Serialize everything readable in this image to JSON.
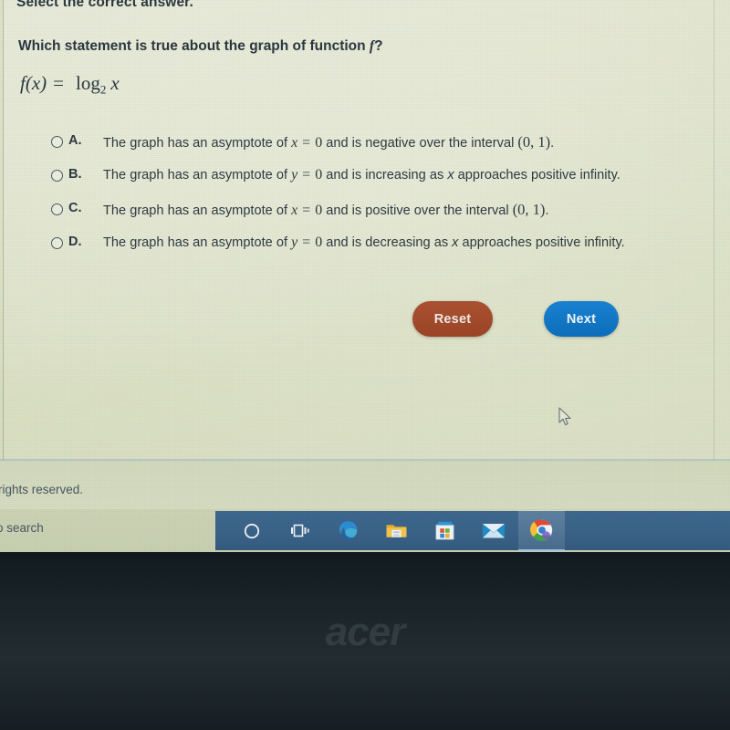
{
  "quiz": {
    "instruction": "Select the correct answer.",
    "question_prefix": "Which statement is true about the graph of function ",
    "question_function": "f",
    "question_suffix": "?",
    "formula": {
      "lhs": "f(x)",
      "equals": "=",
      "log_word": "log",
      "base": "2",
      "argument": "x"
    },
    "options": [
      {
        "letter": "A.",
        "selected": false,
        "text_before_var": "The graph has an asymptote of ",
        "variable": "x",
        "equals": "=",
        "value": "0",
        "text_after": " and is negative over the interval ",
        "interval": "(0, 1)",
        "period": "."
      },
      {
        "letter": "B.",
        "selected": false,
        "text_before_var": "The graph has an asymptote of ",
        "variable": "y",
        "equals": "=",
        "value": "0",
        "text_after": " and is increasing as ",
        "trailing_var": "x",
        "text_end": " approaches positive infinity.",
        "interval": "",
        "period": ""
      },
      {
        "letter": "C.",
        "selected": false,
        "text_before_var": "The graph has an asymptote of ",
        "variable": "x",
        "equals": "=",
        "value": "0",
        "text_after": " and is positive over the interval ",
        "interval": "(0, 1)",
        "period": "."
      },
      {
        "letter": "D.",
        "selected": false,
        "text_before_var": "The graph has an asymptote of ",
        "variable": "y",
        "equals": "=",
        "value": "0",
        "text_after": " and is decreasing as ",
        "trailing_var": "x",
        "text_end": " approaches positive infinity.",
        "interval": "",
        "period": ""
      }
    ],
    "buttons": {
      "reset_label": "Reset",
      "next_label": "Next",
      "reset_color": "#a04a2c",
      "next_color": "#0f74c2"
    }
  },
  "footer": {
    "copyright_text": "rights reserved."
  },
  "taskbar": {
    "search_text": "o search",
    "items": [
      {
        "name": "cortana-icon",
        "label": "Cortana"
      },
      {
        "name": "task-view-icon",
        "label": "Task View"
      },
      {
        "name": "edge-icon",
        "label": "Microsoft Edge"
      },
      {
        "name": "file-explorer-icon",
        "label": "File Explorer"
      },
      {
        "name": "microsoft-store-icon",
        "label": "Microsoft Store"
      },
      {
        "name": "mail-icon",
        "label": "Mail"
      },
      {
        "name": "chrome-icon",
        "label": "Google Chrome"
      }
    ],
    "background_color": "#3a6389",
    "active_item": "chrome-icon"
  },
  "device": {
    "brand_logo": "acer",
    "bezel_color": "#1b2529"
  }
}
